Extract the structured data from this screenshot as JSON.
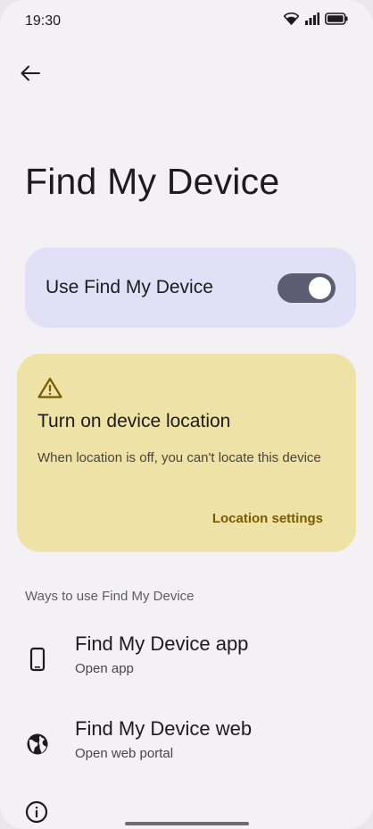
{
  "status_bar": {
    "time": "19:30",
    "icons": [
      "wifi-icon",
      "signal-icon",
      "battery-icon"
    ]
  },
  "header": {
    "back_icon": "arrow-back-icon",
    "title": "Find My Device"
  },
  "main_switch": {
    "label": "Use Find My Device",
    "state": "on",
    "card_color": "#e1e0f7"
  },
  "location_warning": {
    "icon": "warning-icon",
    "title": "Turn on device location",
    "body": "When location is off, you can't locate this device",
    "action_label": "Location settings",
    "card_color": "#eee2a6",
    "accent_color": "#7a5a00"
  },
  "ways_section": {
    "header": "Ways to use Find My Device",
    "items": [
      {
        "icon": "phone-icon",
        "title": "Find My Device app",
        "subtitle": "Open app"
      },
      {
        "icon": "globe-icon",
        "title": "Find My Device web",
        "subtitle": "Open web portal"
      }
    ],
    "partial_item_icon": "info-icon"
  }
}
